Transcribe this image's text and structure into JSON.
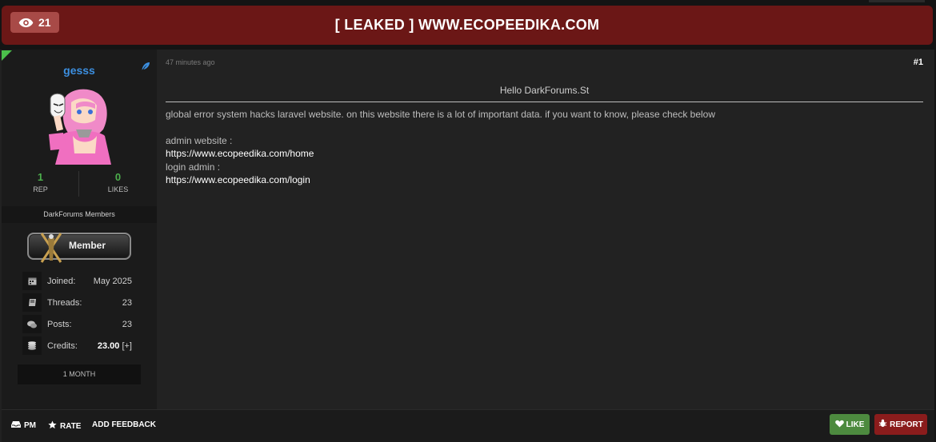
{
  "thread": {
    "view_count": "21",
    "title": "[ LEAKED ] WWW.ECOPEEDIKA.COM"
  },
  "author": {
    "username": "gesss",
    "rep_value": "1",
    "rep_label": "REP",
    "likes_value": "0",
    "likes_label": "LIKES",
    "group": "DarkForums Members",
    "rank": "Member",
    "info": [
      {
        "label": "Joined:",
        "value": "May 2025",
        "icon": "calendar-icon"
      },
      {
        "label": "Threads:",
        "value": "23",
        "icon": "book-icon"
      },
      {
        "label": "Posts:",
        "value": "23",
        "icon": "comments-icon"
      },
      {
        "label": "Credits:",
        "value": "23.00",
        "extra": "[+]",
        "icon": "coins-icon"
      }
    ],
    "membership_duration": "1 MONTH"
  },
  "post": {
    "date": "47 minutes ago",
    "number": "#1",
    "heading": "Hello DarkForums.St",
    "intro": "global error system hacks laravel website. on this website there is a lot of important data. if you want to know, please check below",
    "admin_label": "admin website :",
    "admin_url": "https://www.ecopeedika.com/home",
    "login_label": "login admin :",
    "login_url": "https://www.ecopeedika.com/login"
  },
  "footer": {
    "pm": "PM",
    "rate": "RATE",
    "feedback": "ADD FEEDBACK",
    "like": "LIKE",
    "report": "REPORT"
  },
  "colors": {
    "title_bar": "#6b1716",
    "username": "#3c8fe0",
    "stat_value": "#4cae4c",
    "like_button": "#4d8a3f",
    "report_button": "#8a1c1c"
  }
}
